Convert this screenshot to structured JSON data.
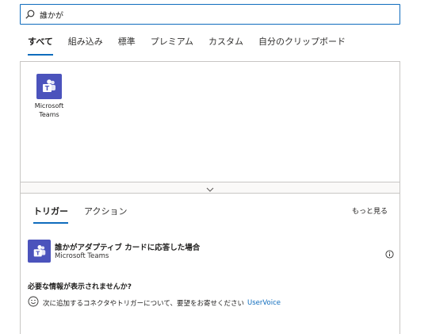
{
  "search": {
    "value": "誰かが"
  },
  "tabs": [
    {
      "label": "すべて",
      "active": true
    },
    {
      "label": "組み込み"
    },
    {
      "label": "標準"
    },
    {
      "label": "プレミアム"
    },
    {
      "label": "カスタム"
    },
    {
      "label": "自分のクリップボード"
    }
  ],
  "connectors": [
    {
      "label": "Microsoft Teams",
      "icon": "teams-icon",
      "color": "#4b53bc"
    }
  ],
  "results": {
    "subtabs": [
      {
        "label": "トリガー",
        "active": true
      },
      {
        "label": "アクション"
      }
    ],
    "see_more": "もっと見る",
    "items": [
      {
        "title": "誰かがアダプティブ カードに応答した場合",
        "connector": "Microsoft Teams"
      }
    ],
    "missing_info_title": "必要な情報が表示されませんか?",
    "feedback_text": "次に追加するコネクタやトリガーについて、要望をお寄せください",
    "feedback_link": "UserVoice"
  },
  "colors": {
    "accent": "#0f6cbd",
    "teams": "#4b53bc",
    "border": "#c8c6c4"
  }
}
